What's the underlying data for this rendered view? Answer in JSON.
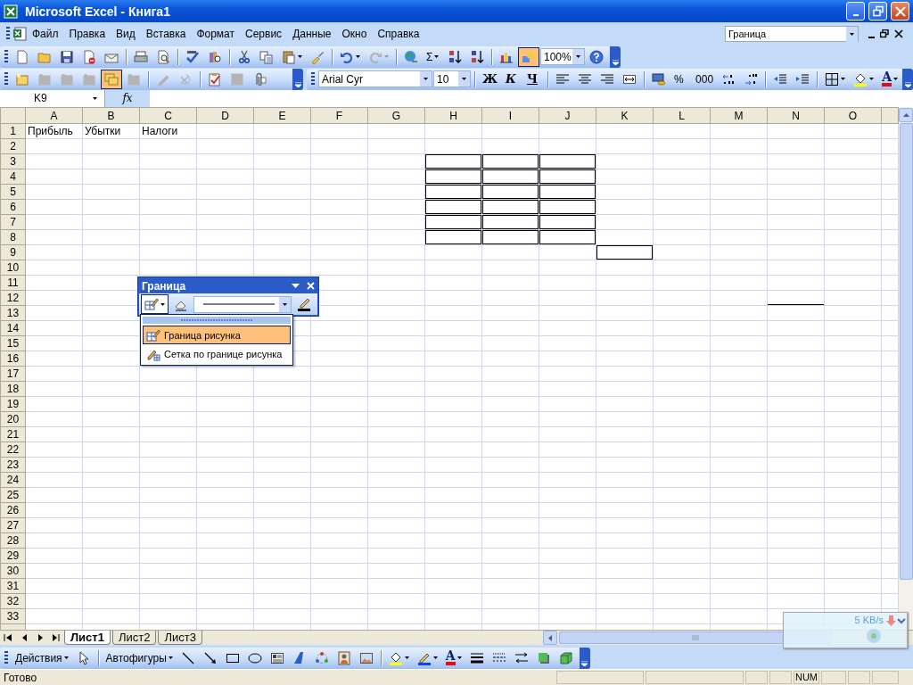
{
  "window": {
    "title": "Microsoft Excel - Книга1"
  },
  "menu": [
    "Файл",
    "Правка",
    "Вид",
    "Вставка",
    "Формат",
    "Сервис",
    "Данные",
    "Окно",
    "Справка"
  ],
  "question_box": {
    "value": "Граница"
  },
  "standard_toolbar": [
    {
      "kind": "button",
      "pressed": false,
      "disabled": false
    },
    {
      "kind": "button",
      "pressed": false,
      "disabled": false
    },
    {
      "kind": "button",
      "pressed": false,
      "disabled": false
    },
    {
      "kind": "button",
      "pressed": false,
      "disabled": false
    },
    {
      "kind": "button",
      "pressed": false,
      "disabled": false
    },
    {
      "kind": "sep"
    },
    {
      "kind": "button",
      "pressed": false,
      "disabled": false
    },
    {
      "kind": "button",
      "pressed": false,
      "disabled": false
    },
    {
      "kind": "sep"
    },
    {
      "kind": "button",
      "pressed": false,
      "disabled": false
    },
    {
      "kind": "button",
      "pressed": false,
      "disabled": false
    },
    {
      "kind": "sep"
    },
    {
      "kind": "button",
      "pressed": false,
      "disabled": false
    },
    {
      "kind": "button",
      "pressed": false,
      "disabled": false
    },
    {
      "kind": "split",
      "pressed": false,
      "disabled": false
    },
    {
      "kind": "button",
      "pressed": false,
      "disabled": false
    },
    {
      "kind": "sep"
    },
    {
      "kind": "split",
      "pressed": false,
      "disabled": false
    },
    {
      "kind": "split",
      "pressed": false,
      "disabled": true
    },
    {
      "kind": "sep"
    },
    {
      "kind": "button",
      "pressed": false,
      "disabled": false
    },
    {
      "kind": "textsplit",
      "label": "Σ"
    },
    {
      "kind": "button",
      "pressed": false,
      "disabled": false
    },
    {
      "kind": "button",
      "pressed": false,
      "disabled": false
    },
    {
      "kind": "sep"
    },
    {
      "kind": "button",
      "pressed": false,
      "disabled": false
    },
    {
      "kind": "button",
      "pressed": true,
      "disabled": false
    },
    {
      "kind": "combo",
      "value": "100%"
    },
    {
      "kind": "button",
      "pressed": false,
      "disabled": false
    }
  ],
  "reviewing_toolbar": [
    {
      "kind": "button",
      "pressed": false,
      "disabled": false
    },
    {
      "kind": "button",
      "pressed": false,
      "disabled": true
    },
    {
      "kind": "button",
      "pressed": false,
      "disabled": true
    },
    {
      "kind": "button",
      "pressed": false,
      "disabled": true
    },
    {
      "kind": "button",
      "pressed": true,
      "disabled": false
    },
    {
      "kind": "button",
      "pressed": false,
      "disabled": true
    },
    {
      "kind": "sep"
    },
    {
      "kind": "button",
      "pressed": false,
      "disabled": true
    },
    {
      "kind": "button",
      "pressed": false,
      "disabled": true
    },
    {
      "kind": "sep"
    },
    {
      "kind": "button",
      "pressed": false,
      "disabled": false
    },
    {
      "kind": "button",
      "pressed": false,
      "disabled": true
    },
    {
      "kind": "button",
      "pressed": false,
      "disabled": false
    }
  ],
  "formatting_toolbar": [
    {
      "kind": "combo",
      "value": "Arial Cyr"
    },
    {
      "kind": "combo",
      "value": "10"
    },
    {
      "kind": "sep"
    },
    {
      "kind": "bold",
      "label": "Ж"
    },
    {
      "kind": "italic",
      "label": "К"
    },
    {
      "kind": "underline",
      "label": "Ч"
    },
    {
      "kind": "sep"
    },
    {
      "kind": "button",
      "pressed": false,
      "disabled": false
    },
    {
      "kind": "button",
      "pressed": false,
      "disabled": false
    },
    {
      "kind": "button",
      "pressed": false,
      "disabled": false
    },
    {
      "kind": "button",
      "pressed": false,
      "disabled": false
    },
    {
      "kind": "sep"
    },
    {
      "kind": "button",
      "pressed": false,
      "disabled": false
    },
    {
      "kind": "text",
      "label": "%"
    },
    {
      "kind": "text",
      "label": "000"
    },
    {
      "kind": "button",
      "pressed": false,
      "disabled": false
    },
    {
      "kind": "button",
      "pressed": false,
      "disabled": false
    },
    {
      "kind": "sep"
    },
    {
      "kind": "button",
      "pressed": false,
      "disabled": false
    },
    {
      "kind": "button",
      "pressed": false,
      "disabled": false
    },
    {
      "kind": "sep"
    },
    {
      "kind": "split",
      "pressed": false,
      "disabled": false
    },
    {
      "kind": "split",
      "pressed": false,
      "disabled": false
    },
    {
      "kind": "font-color",
      "label": "A"
    }
  ],
  "formula_bar": {
    "name_box": "K9",
    "fx": "fx"
  },
  "sheet": {
    "columns": [
      "A",
      "B",
      "C",
      "D",
      "E",
      "F",
      "G",
      "H",
      "I",
      "J",
      "K",
      "L",
      "M",
      "N",
      "O"
    ],
    "rows": [
      {
        "label": "1",
        "cells": [
          {
            "text": "Прибыль",
            "boxed": false,
            "bottom_border": false
          },
          {
            "text": "Убытки",
            "boxed": false,
            "bottom_border": false
          },
          {
            "text": "Налоги",
            "boxed": false,
            "bottom_border": false
          }
        ]
      },
      {
        "label": "2"
      },
      {
        "label": "3",
        "cells": [
          {
            "boxed": false,
            "bottom_border": false
          },
          {
            "boxed": false,
            "bottom_border": false
          },
          {
            "boxed": false,
            "bottom_border": false
          },
          {
            "boxed": false,
            "bottom_border": false
          },
          {
            "boxed": false,
            "bottom_border": false
          },
          {
            "boxed": false,
            "bottom_border": false
          },
          {
            "boxed": false,
            "bottom_border": false
          },
          {
            "boxed": true,
            "bottom_border": false
          },
          {
            "boxed": true,
            "bottom_border": false
          },
          {
            "boxed": true,
            "bottom_border": false
          }
        ]
      },
      {
        "label": "4",
        "cells": [
          {
            "boxed": false,
            "bottom_border": false
          },
          {
            "boxed": false,
            "bottom_border": false
          },
          {
            "boxed": false,
            "bottom_border": false
          },
          {
            "boxed": false,
            "bottom_border": false
          },
          {
            "boxed": false,
            "bottom_border": false
          },
          {
            "boxed": false,
            "bottom_border": false
          },
          {
            "boxed": false,
            "bottom_border": false
          },
          {
            "boxed": true,
            "bottom_border": false
          },
          {
            "boxed": true,
            "bottom_border": false
          },
          {
            "boxed": true,
            "bottom_border": false
          }
        ]
      },
      {
        "label": "5",
        "cells": [
          {
            "boxed": false,
            "bottom_border": false
          },
          {
            "boxed": false,
            "bottom_border": false
          },
          {
            "boxed": false,
            "bottom_border": false
          },
          {
            "boxed": false,
            "bottom_border": false
          },
          {
            "boxed": false,
            "bottom_border": false
          },
          {
            "boxed": false,
            "bottom_border": false
          },
          {
            "boxed": false,
            "bottom_border": false
          },
          {
            "boxed": true,
            "bottom_border": false
          },
          {
            "boxed": true,
            "bottom_border": false
          },
          {
            "boxed": true,
            "bottom_border": false
          }
        ]
      },
      {
        "label": "6",
        "cells": [
          {
            "boxed": false,
            "bottom_border": false
          },
          {
            "boxed": false,
            "bottom_border": false
          },
          {
            "boxed": false,
            "bottom_border": false
          },
          {
            "boxed": false,
            "bottom_border": false
          },
          {
            "boxed": false,
            "bottom_border": false
          },
          {
            "boxed": false,
            "bottom_border": false
          },
          {
            "boxed": false,
            "bottom_border": false
          },
          {
            "boxed": true,
            "bottom_border": false
          },
          {
            "boxed": true,
            "bottom_border": false
          },
          {
            "boxed": true,
            "bottom_border": false
          }
        ]
      },
      {
        "label": "7",
        "cells": [
          {
            "boxed": false,
            "bottom_border": false
          },
          {
            "boxed": false,
            "bottom_border": false
          },
          {
            "boxed": false,
            "bottom_border": false
          },
          {
            "boxed": false,
            "bottom_border": false
          },
          {
            "boxed": false,
            "bottom_border": false
          },
          {
            "boxed": false,
            "bottom_border": false
          },
          {
            "boxed": false,
            "bottom_border": false
          },
          {
            "boxed": true,
            "bottom_border": false
          },
          {
            "boxed": true,
            "bottom_border": false
          },
          {
            "boxed": true,
            "bottom_border": false
          }
        ]
      },
      {
        "label": "8",
        "cells": [
          {
            "boxed": false,
            "bottom_border": false
          },
          {
            "boxed": false,
            "bottom_border": false
          },
          {
            "boxed": false,
            "bottom_border": false
          },
          {
            "boxed": false,
            "bottom_border": false
          },
          {
            "boxed": false,
            "bottom_border": false
          },
          {
            "boxed": false,
            "bottom_border": false
          },
          {
            "boxed": false,
            "bottom_border": false
          },
          {
            "boxed": true,
            "bottom_border": false
          },
          {
            "boxed": true,
            "bottom_border": false
          },
          {
            "boxed": true,
            "bottom_border": false
          }
        ]
      },
      {
        "label": "9",
        "cells": [
          {
            "boxed": false,
            "bottom_border": false
          },
          {
            "boxed": false,
            "bottom_border": false
          },
          {
            "boxed": false,
            "bottom_border": false
          },
          {
            "boxed": false,
            "bottom_border": false
          },
          {
            "boxed": false,
            "bottom_border": false
          },
          {
            "boxed": false,
            "bottom_border": false
          },
          {
            "boxed": false,
            "bottom_border": false
          },
          {
            "boxed": false,
            "bottom_border": false
          },
          {
            "boxed": false,
            "bottom_border": false
          },
          {
            "boxed": false,
            "bottom_border": false
          },
          {
            "boxed": true,
            "bottom_border": false
          }
        ]
      },
      {
        "label": "10"
      },
      {
        "label": "11"
      },
      {
        "label": "12",
        "cells": [
          {
            "boxed": false,
            "bottom_border": false
          },
          {
            "boxed": false,
            "bottom_border": false
          },
          null,
          null,
          null,
          {
            "boxed": false,
            "bottom_border": false
          },
          {
            "boxed": false,
            "bottom_border": false
          },
          {
            "boxed": false,
            "bottom_border": false
          },
          {
            "boxed": false,
            "bottom_border": false
          },
          {
            "boxed": false,
            "bottom_border": false
          },
          {
            "boxed": false,
            "bottom_border": false
          },
          {
            "boxed": false,
            "bottom_border": false
          },
          {
            "boxed": false,
            "bottom_border": false
          },
          {
            "boxed": false,
            "bottom_border": true
          }
        ]
      },
      {
        "label": "13"
      },
      {
        "label": "14"
      },
      {
        "label": "15"
      },
      {
        "label": "16"
      },
      {
        "label": "17"
      },
      {
        "label": "18"
      },
      {
        "label": "19"
      },
      {
        "label": "20"
      },
      {
        "label": "21"
      },
      {
        "label": "22"
      },
      {
        "label": "23"
      },
      {
        "label": "24"
      },
      {
        "label": "25"
      },
      {
        "label": "26"
      },
      {
        "label": "27"
      },
      {
        "label": "28"
      },
      {
        "label": "29"
      },
      {
        "label": "30"
      },
      {
        "label": "31"
      },
      {
        "label": "32"
      },
      {
        "label": "33"
      }
    ]
  },
  "sheet_tabs": [
    {
      "label": "Лист1",
      "selected": true
    },
    {
      "label": "Лист2",
      "selected": false
    },
    {
      "label": "Лист3",
      "selected": false
    }
  ],
  "border_toolbar": {
    "title": "Граница",
    "items": [
      {
        "kind": "split",
        "pressed": true,
        "disabled": false
      },
      {
        "kind": "button",
        "pressed": false,
        "disabled": false
      },
      {
        "kind": "line-style"
      },
      {
        "kind": "button",
        "pressed": false,
        "disabled": false
      }
    ],
    "menu": [
      {
        "label": "Граница рисунка",
        "selected": true
      },
      {
        "label": "Сетка по границе рисунка",
        "selected": false
      }
    ]
  },
  "drawing_toolbar": [
    {
      "kind": "textsplit",
      "label": "Действия"
    },
    {
      "kind": "button",
      "pressed": false,
      "disabled": false
    },
    {
      "kind": "sep"
    },
    {
      "kind": "textsplit",
      "label": "Автофигуры"
    },
    {
      "kind": "button",
      "pressed": false,
      "disabled": false
    },
    {
      "kind": "button",
      "pressed": false,
      "disabled": false
    },
    {
      "kind": "button",
      "pressed": false,
      "disabled": false
    },
    {
      "kind": "button",
      "pressed": false,
      "disabled": false
    },
    {
      "kind": "button",
      "pressed": false,
      "disabled": false
    },
    {
      "kind": "button",
      "pressed": false,
      "disabled": false
    },
    {
      "kind": "button",
      "pressed": false,
      "disabled": false
    },
    {
      "kind": "button",
      "pressed": false,
      "disabled": false
    },
    {
      "kind": "button",
      "pressed": false,
      "disabled": false
    },
    {
      "kind": "sep"
    },
    {
      "kind": "split",
      "pressed": false,
      "disabled": false
    },
    {
      "kind": "split",
      "pressed": false,
      "disabled": false
    },
    {
      "kind": "font-color",
      "label": "A"
    },
    {
      "kind": "button",
      "pressed": false,
      "disabled": false
    },
    {
      "kind": "button",
      "pressed": false,
      "disabled": false
    },
    {
      "kind": "button",
      "pressed": false,
      "disabled": false
    },
    {
      "kind": "button",
      "pressed": false,
      "disabled": false
    },
    {
      "kind": "button",
      "pressed": false,
      "disabled": false
    }
  ],
  "status_bar": {
    "text": "Готово",
    "indicators": [
      "NUM"
    ]
  },
  "overlay": {
    "speed": "5 KB/s"
  }
}
